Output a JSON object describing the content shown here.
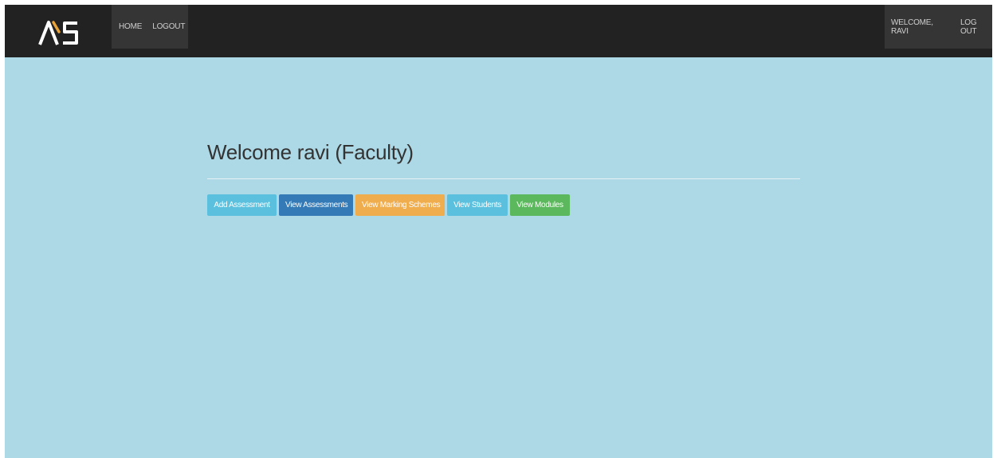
{
  "navbar": {
    "logo_text": "AS",
    "left_links": [
      "HOME",
      "LOGOUT"
    ],
    "right_links": [
      "WELCOME, RAVI",
      "LOG OUT"
    ]
  },
  "main": {
    "title": "Welcome ravi (Faculty)",
    "buttons": [
      {
        "label": "Add Assessment",
        "color": "#5bc0de"
      },
      {
        "label": "View Assessments",
        "color": "#337ab7"
      },
      {
        "label": "View Marking Schemes",
        "color": "#f0ad4e"
      },
      {
        "label": "View Students",
        "color": "#5bc0de"
      },
      {
        "label": "View Modules",
        "color": "#5cb85c"
      }
    ]
  },
  "colors": {
    "navbar": "#222222",
    "nav_link_block": "#353535",
    "page_background": "#add8e5",
    "logo_white": "#ffffff",
    "logo_gold": "#e8a33a"
  }
}
